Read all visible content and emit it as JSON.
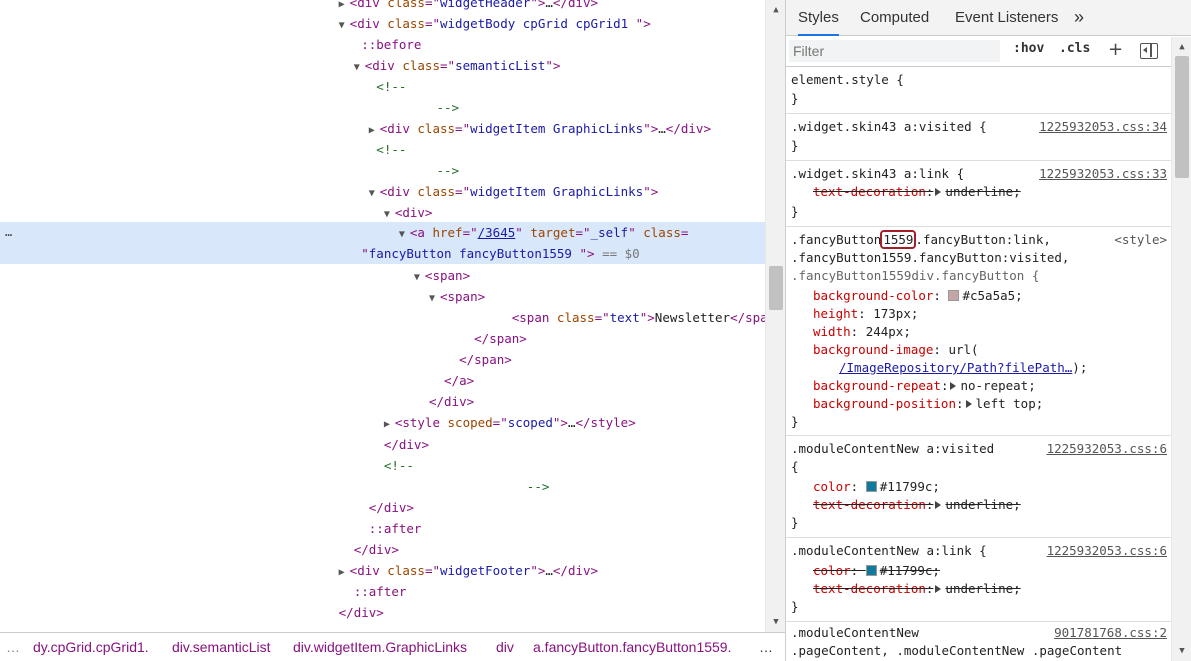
{
  "dom": {
    "line0": {
      "open": "<",
      "tag": "div",
      "attr": "class",
      "val": "widgetHeader",
      "rest": ">…</",
      "ctag": "div",
      "close": ">"
    },
    "line1": {
      "tag": "div",
      "attr": "class",
      "val": "widgetBody cpGrid cpGrid1 "
    },
    "line2": {
      "text": "::before"
    },
    "line3": {
      "tag": "div",
      "attr": "class",
      "val": "semanticList"
    },
    "line4": {
      "text": "<!--"
    },
    "line5": {
      "text": "-->"
    },
    "line6": {
      "tag": "div",
      "attr": "class",
      "val": "widgetItem GraphicLinks",
      "rest": "…",
      "ctag": "div"
    },
    "line7": {
      "text": "<!--"
    },
    "line8": {
      "text": "-->"
    },
    "line9": {
      "tag": "div",
      "attr": "class",
      "val": "widgetItem GraphicLinks"
    },
    "line10": {
      "tag": "div"
    },
    "line11": {
      "tag": "a",
      "attr1": "href",
      "val1": "/3645",
      "attr2": "target",
      "val2": "_self",
      "attr3": "class"
    },
    "line12": {
      "val": "fancyButton fancyButton1559 ",
      "dollar": "== $0"
    },
    "line13": {
      "tag": "span"
    },
    "line14": {
      "tag": "span"
    },
    "line15": {
      "tag": "span",
      "attr": "class",
      "val": "text",
      "text": "Newsletter",
      "ctag": "span"
    },
    "line16": {
      "ctag": "span"
    },
    "line17": {
      "ctag": "span"
    },
    "line18": {
      "ctag": "a"
    },
    "line19": {
      "ctag": "div"
    },
    "line20": {
      "tag": "style",
      "attr": "scoped",
      "val": "scoped",
      "rest": "…",
      "ctag": "style"
    },
    "line21": {
      "ctag": "div"
    },
    "line22": {
      "text": "<!--"
    },
    "line23": {
      "text": "-->"
    },
    "line24": {
      "ctag": "div"
    },
    "line25": {
      "text": "::after"
    },
    "line26": {
      "ctag": "div"
    },
    "line27": {
      "tag": "div",
      "attr": "class",
      "val": "widgetFooter",
      "rest": "…",
      "ctag": "div"
    },
    "line28": {
      "text": "::after"
    },
    "line29": {
      "ctag": "div"
    },
    "dots": "…"
  },
  "breadcrumb": {
    "first": "…",
    "items": [
      "dy.cpGrid.cpGrid1.",
      "div.semanticList",
      "div.widgetItem.GraphicLinks",
      "div",
      "a.fancyButton.fancyButton1559."
    ],
    "more": "…"
  },
  "sidebar": {
    "tabs": [
      "Styles",
      "Computed",
      "Event Listeners",
      "»"
    ],
    "filter_placeholder": "Filter",
    "hov": ":hov",
    "cls": ".cls",
    "plus": "+"
  },
  "rules": {
    "r0": {
      "selector": "element.style {",
      "close": "}"
    },
    "r1": {
      "selector": ".widget.skin43 a:visited {",
      "source": "1225932053.css:34",
      "close": "}"
    },
    "r2": {
      "selector": ".widget.skin43 a:link {",
      "source": "1225932053.css:33",
      "prop": "text-decoration",
      "value": "underline;",
      "close": "}"
    },
    "r3": {
      "sel_a": ".fancyButton",
      "sel_hl": "1559",
      "sel_b": ".fancyButton:link,",
      "source": "<style>",
      "sel2": ".fancyButton1559.fancyButton:visited,",
      "sel3": ".fancyButton1559div.fancyButton {",
      "bg_prop": "background-color",
      "bg_color": "#c5a5a5",
      "bg_val": "#c5a5a5;",
      "h_prop": "height",
      "h_val": "173px;",
      "w_prop": "width",
      "w_val": "244px;",
      "img_prop": "background-image",
      "img_val": "url(",
      "img_url": "/ImageRepository/Path?filePath…",
      "img_end": ");",
      "rep_prop": "background-repeat",
      "rep_val": "no-repeat;",
      "pos_prop": "background-position",
      "pos_val": "left top;",
      "close": "}"
    },
    "r4": {
      "selector": ".moduleContentNew a:visited",
      "source": "1225932053.css:6",
      "brace": "{",
      "prop1": "color",
      "color": "#11799c",
      "val1": "#11799c;",
      "prop2": "text-decoration",
      "val2": "underline;",
      "close": "}"
    },
    "r5": {
      "selector": ".moduleContentNew a:link {",
      "source": "1225932053.css:6",
      "prop1": "color",
      "color": "#11799c",
      "val1": "#11799c;",
      "prop2": "text-decoration",
      "val2": "underline;",
      "close": "}"
    },
    "r6": {
      "selector": ".moduleContentNew",
      "source": "901781768.css:2",
      "sel2": ".pageContent, .moduleContentNew .pageContent"
    }
  }
}
